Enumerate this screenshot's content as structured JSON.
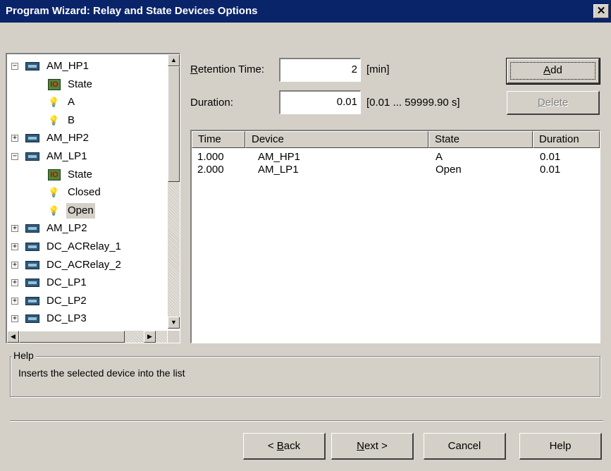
{
  "window": {
    "title": "Program Wizard: Relay and State Devices Options",
    "close_glyph": "✕"
  },
  "tree": {
    "items": [
      {
        "label": "AM_HP1",
        "kind": "device",
        "expander": "−"
      },
      {
        "label": "State",
        "kind": "state",
        "icon_text": "IO"
      },
      {
        "label": "A",
        "kind": "bulb"
      },
      {
        "label": "B",
        "kind": "bulb"
      },
      {
        "label": "AM_HP2",
        "kind": "device",
        "expander": "+"
      },
      {
        "label": "AM_LP1",
        "kind": "device",
        "expander": "−"
      },
      {
        "label": "State",
        "kind": "state",
        "icon_text": "IO"
      },
      {
        "label": "Closed",
        "kind": "bulb"
      },
      {
        "label": "Open",
        "kind": "bulb",
        "selected": true
      },
      {
        "label": "AM_LP2",
        "kind": "device",
        "expander": "+"
      },
      {
        "label": "DC_ACRelay_1",
        "kind": "device",
        "expander": "+"
      },
      {
        "label": "DC_ACRelay_2",
        "kind": "device",
        "expander": "+"
      },
      {
        "label": "DC_LP1",
        "kind": "device",
        "expander": "+"
      },
      {
        "label": "DC_LP2",
        "kind": "device",
        "expander": "+"
      },
      {
        "label": "DC_LP3",
        "kind": "device",
        "expander": "+"
      }
    ]
  },
  "form": {
    "retention_label_first": "R",
    "retention_label_rest": "etention Time:",
    "retention_value": "2",
    "retention_unit": "[min]",
    "duration_label": "Duration:",
    "duration_value": "0.01",
    "duration_range": "[0.01 ... 59999.90 s]",
    "add_label_first": "A",
    "add_label_rest": "dd",
    "delete_label_first": "D",
    "delete_label_rest": "elete"
  },
  "list": {
    "columns": [
      "Time",
      "Device",
      "State",
      "Duration"
    ],
    "rows": [
      {
        "time": "1.000",
        "device": "AM_HP1",
        "state": "A",
        "duration": "0.01"
      },
      {
        "time": "2.000",
        "device": "AM_LP1",
        "state": "Open",
        "duration": "0.01"
      }
    ]
  },
  "help": {
    "legend": "Help",
    "text": "Inserts the selected device into the list"
  },
  "footer": {
    "back_prefix": "< ",
    "back_first": "B",
    "back_rest": "ack",
    "next_first": "N",
    "next_rest": "ext >",
    "cancel_label": "Cancel",
    "help_label": "Help"
  },
  "colors": {
    "titlebar": "#0a246a",
    "face": "#d4d0c8",
    "state_icon_bg": "#4a8a3a",
    "bulb": "#e8c000"
  }
}
